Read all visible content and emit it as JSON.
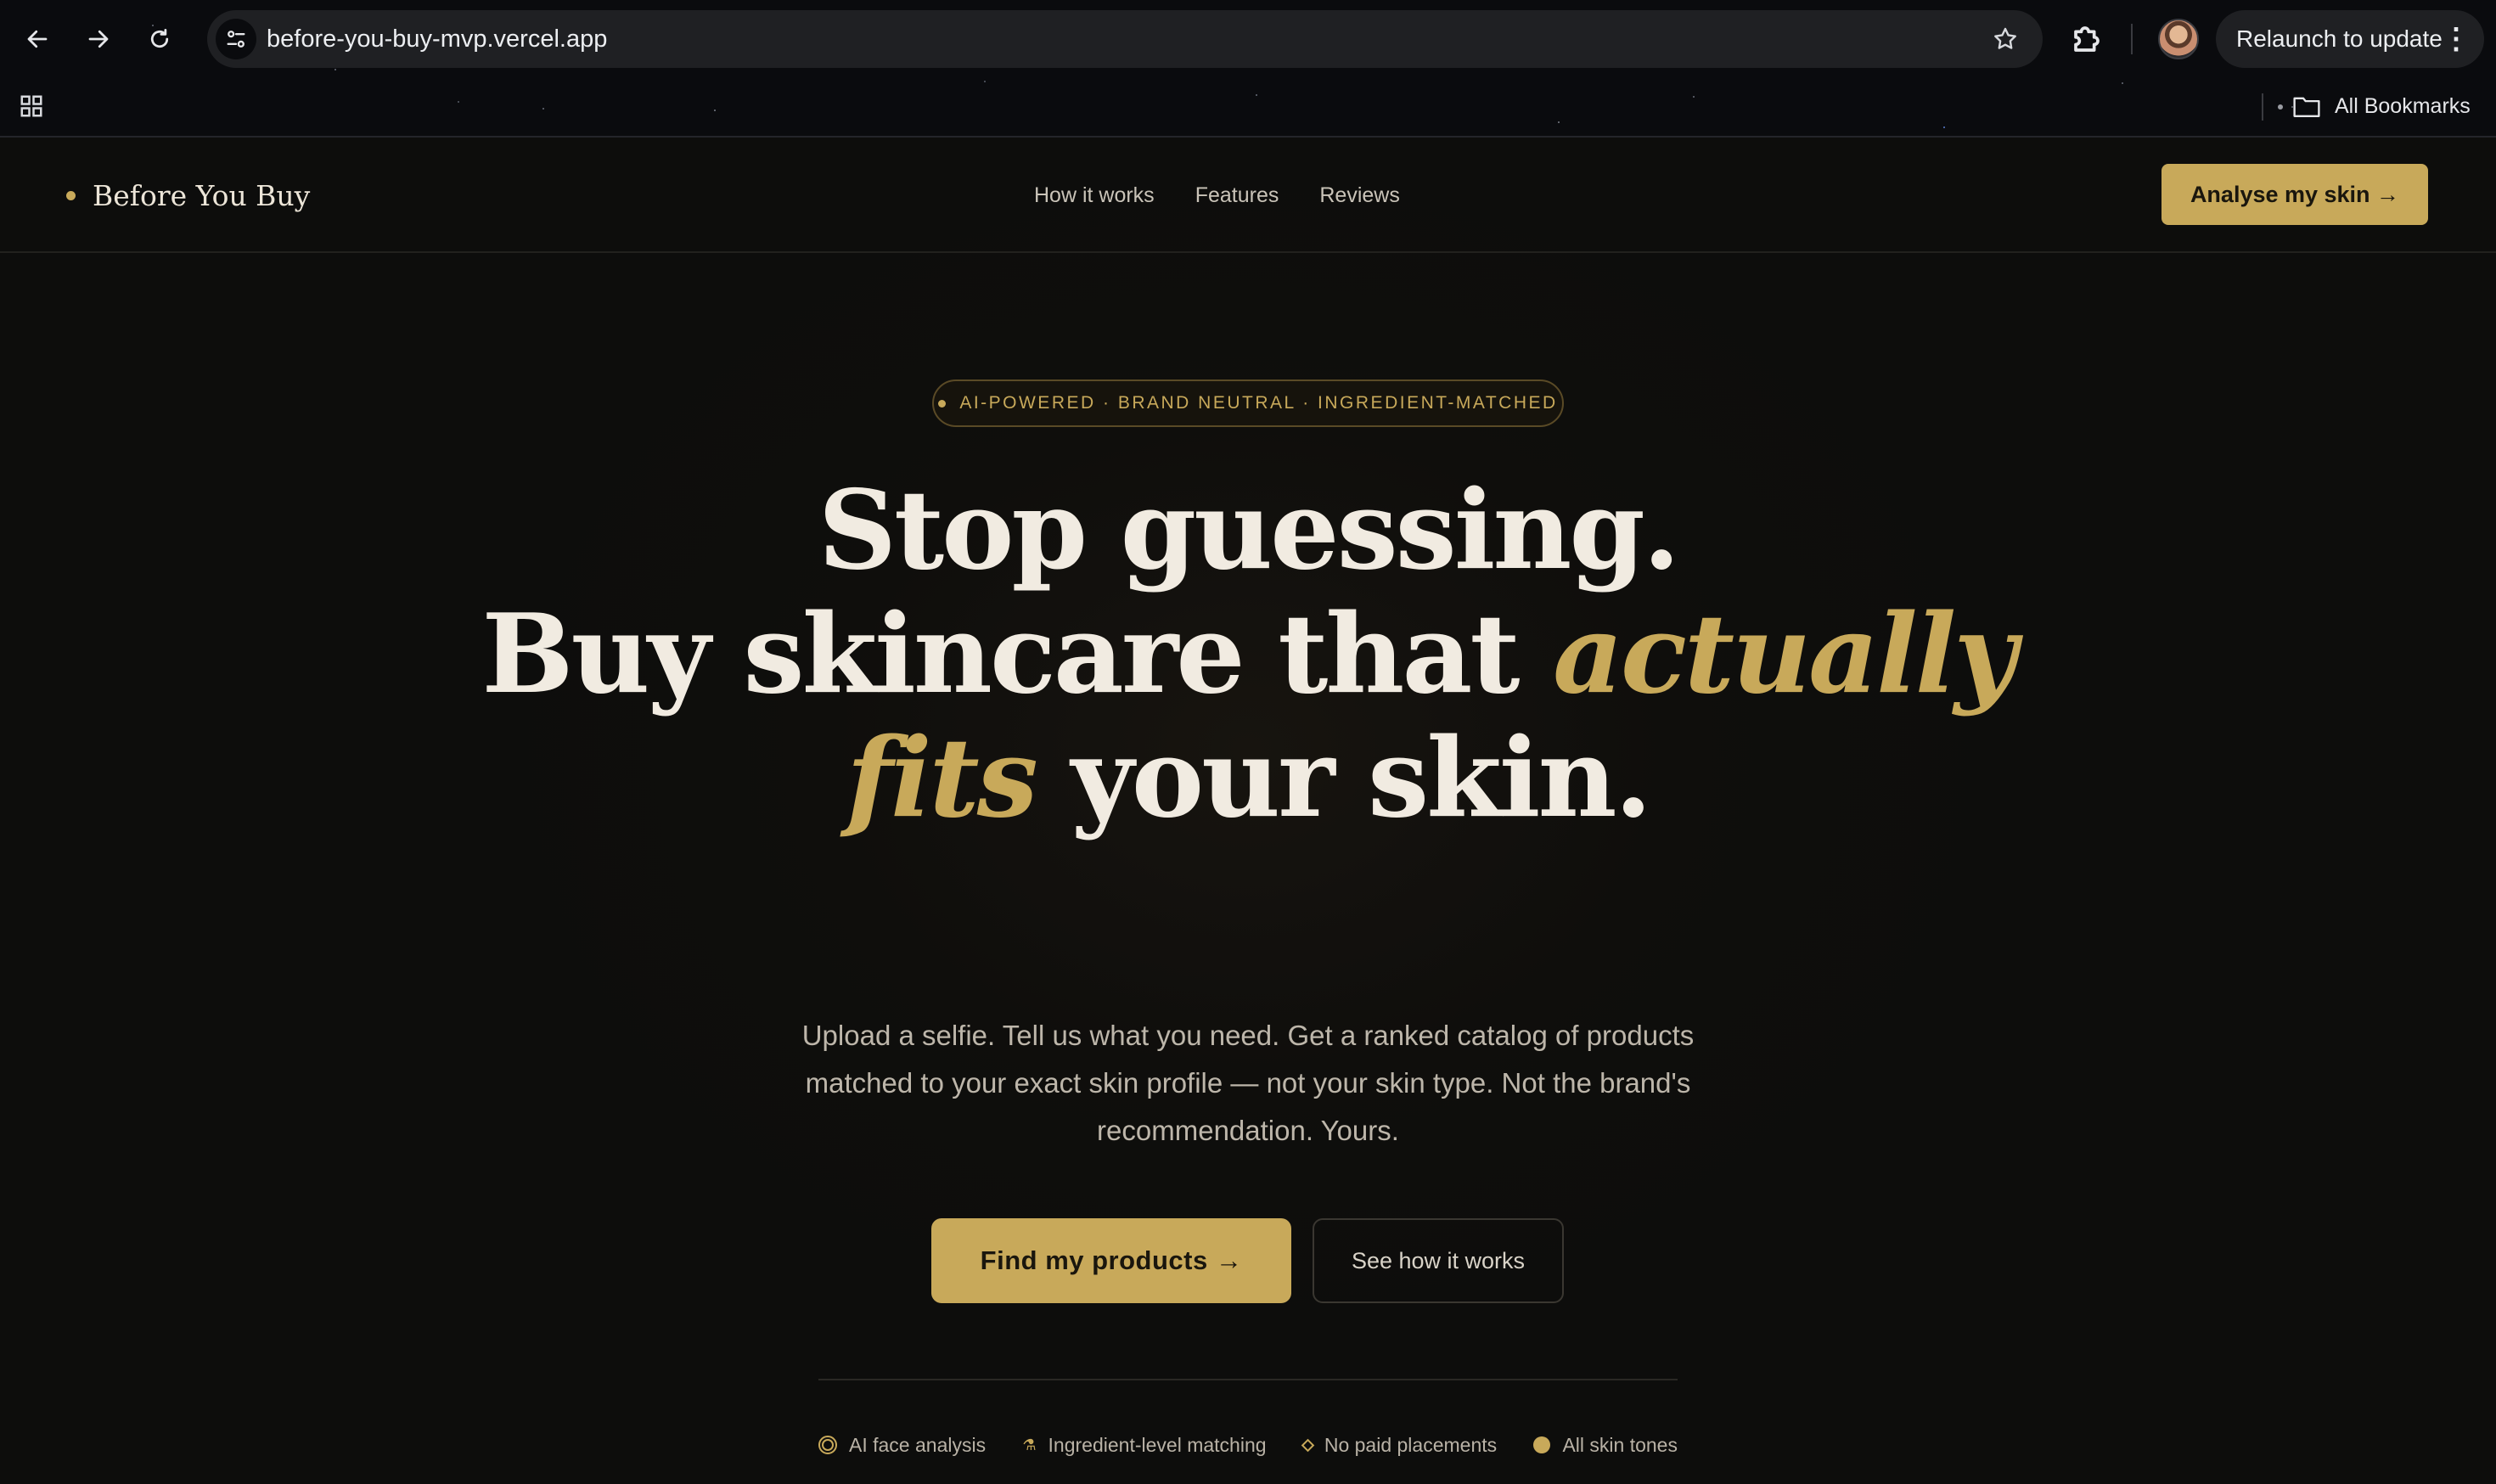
{
  "browser": {
    "url": "before-you-buy-mvp.vercel.app",
    "relaunch_label": "Relaunch to update",
    "bookmarks_label": "All Bookmarks",
    "icons": [
      "back-icon",
      "forward-icon",
      "reload-icon",
      "site-info-icon",
      "bookmark-star-icon",
      "extensions-icon",
      "profile-avatar",
      "more-menu-icon",
      "apps-grid-icon",
      "folder-icon"
    ]
  },
  "nav": {
    "brand": "Before You Buy",
    "links": [
      "How it works",
      "Features",
      "Reviews"
    ],
    "cta": "Analyse my skin →"
  },
  "hero": {
    "badge": "AI-POWERED · BRAND NEUTRAL · INGREDIENT-MATCHED",
    "line1": "Stop guessing.",
    "line2_a": "Buy skincare that ",
    "line2_accent": "actually",
    "line3_accent": "fits",
    "line3_b": " your skin.",
    "subtext": "Upload a selfie. Tell us what you need. Get a ranked catalog of products matched to your exact skin profile — not your skin type. Not the brand's recommendation. Yours.",
    "primary_cta": "Find my products →",
    "secondary_cta": "See how it works"
  },
  "features": [
    {
      "icon": "face-ring-icon",
      "label": "AI face analysis"
    },
    {
      "icon": "flask-icon",
      "label": "Ingredient-level matching"
    },
    {
      "icon": "diamond-icon",
      "label": "No paid placements"
    },
    {
      "icon": "filled-dot-icon",
      "label": "All skin tones"
    }
  ],
  "colors": {
    "accent": "#c8a95a",
    "background": "#0d0d0c",
    "text": "#f1ebe1"
  }
}
